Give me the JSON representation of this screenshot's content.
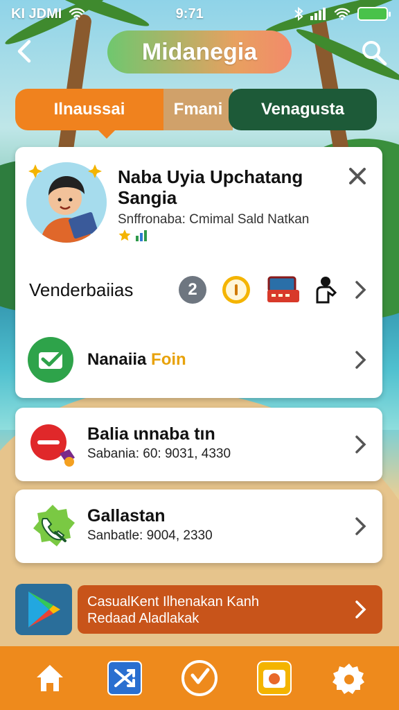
{
  "status_bar": {
    "carrier": "KI JDMI",
    "time": "9:71"
  },
  "header": {
    "title": "Midanegia"
  },
  "tabs": [
    {
      "label": "Ilnaussai"
    },
    {
      "label": "Fmani"
    },
    {
      "label": "Venagusta"
    }
  ],
  "profile_card": {
    "name": "Naba Uyia Upchatang Sangia",
    "subtitle": "Snffronaba: Cmimal Sald Natkan",
    "vendor_row_label": "Venderbaiias",
    "vendor_badge_number": "2",
    "action_row_label_main": "Nanaiia ",
    "action_row_label_accent": "Foin"
  },
  "list_items": [
    {
      "title": "Balia ɩnnaba tın",
      "detail": "Sabania: 60: 9031, 4330"
    },
    {
      "title": "Gallastan",
      "detail": "Sanbatle: 9004, 2330"
    }
  ],
  "promo": {
    "line1": "CasualKent Ilhenakan Kanh",
    "line2": "Redaad Aladlakak"
  },
  "colors": {
    "accent_orange": "#f0821e",
    "dark_green": "#1d5a38",
    "nav_orange": "#ee8a1c",
    "promo_red": "#c8541a",
    "check_green": "#2ea34a"
  },
  "icons": {
    "nav": [
      "home-icon",
      "shuffle-icon",
      "play-icon",
      "camera-icon",
      "gear-icon"
    ]
  }
}
